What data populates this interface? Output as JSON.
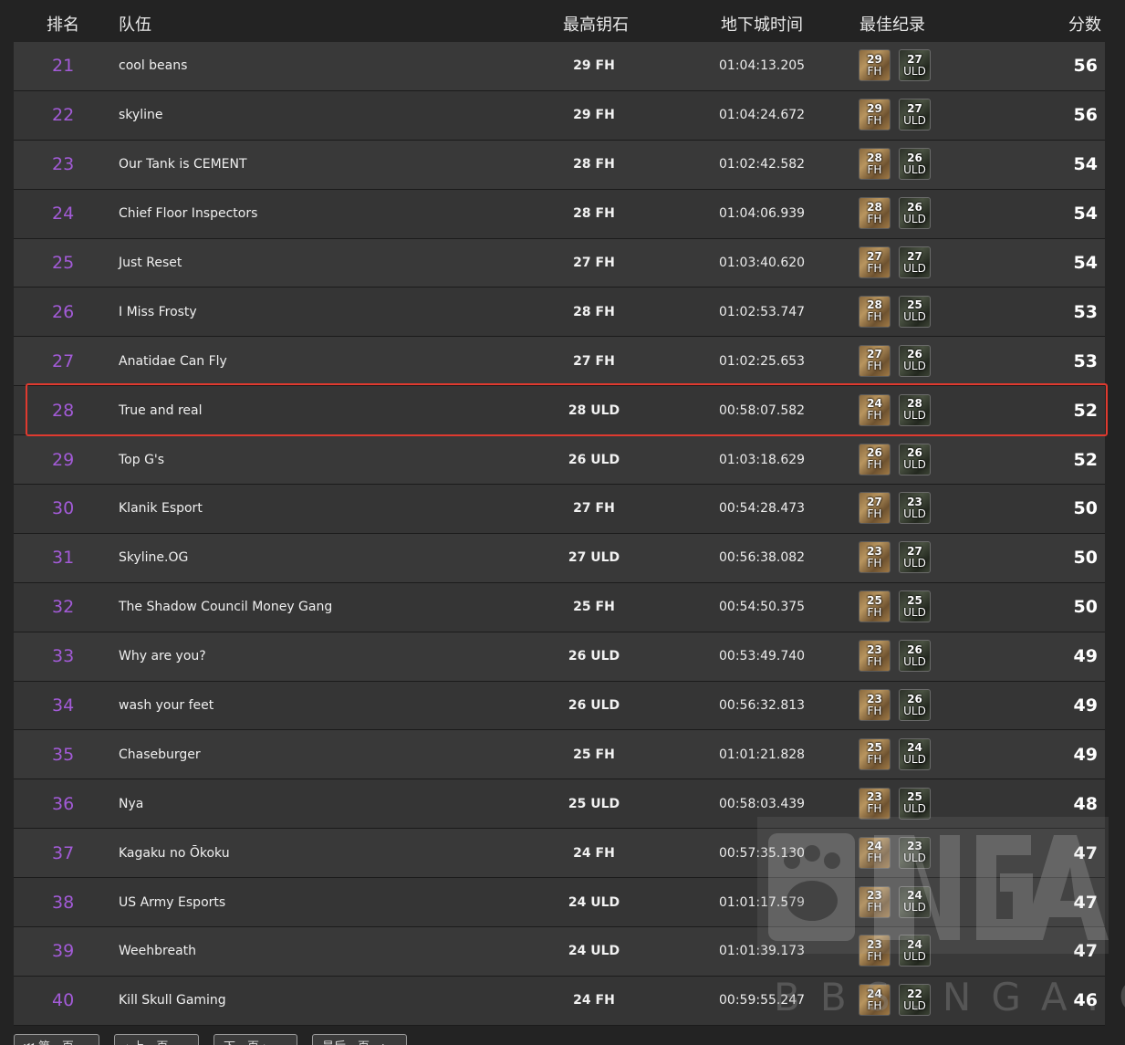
{
  "headers": {
    "rank": "排名",
    "team": "队伍",
    "highest_key": "最高钥石",
    "dungeon_time": "地下城时间",
    "best_record": "最佳纪录",
    "score": "分数"
  },
  "rows": [
    {
      "rank": "21",
      "team": "cool beans",
      "key": "29 FH",
      "time": "01:04:13.205",
      "best": [
        {
          "lvl": "29",
          "dungeon": "FH"
        },
        {
          "lvl": "27",
          "dungeon": "ULD"
        }
      ],
      "score": "56"
    },
    {
      "rank": "22",
      "team": "skyline",
      "key": "29 FH",
      "time": "01:04:24.672",
      "best": [
        {
          "lvl": "29",
          "dungeon": "FH"
        },
        {
          "lvl": "27",
          "dungeon": "ULD"
        }
      ],
      "score": "56"
    },
    {
      "rank": "23",
      "team": "Our Tank is CEMENT",
      "key": "28 FH",
      "time": "01:02:42.582",
      "best": [
        {
          "lvl": "28",
          "dungeon": "FH"
        },
        {
          "lvl": "26",
          "dungeon": "ULD"
        }
      ],
      "score": "54"
    },
    {
      "rank": "24",
      "team": "Chief Floor Inspectors",
      "key": "28 FH",
      "time": "01:04:06.939",
      "best": [
        {
          "lvl": "28",
          "dungeon": "FH"
        },
        {
          "lvl": "26",
          "dungeon": "ULD"
        }
      ],
      "score": "54"
    },
    {
      "rank": "25",
      "team": "Just Reset",
      "key": "27 FH",
      "time": "01:03:40.620",
      "best": [
        {
          "lvl": "27",
          "dungeon": "FH"
        },
        {
          "lvl": "27",
          "dungeon": "ULD"
        }
      ],
      "score": "54"
    },
    {
      "rank": "26",
      "team": "I Miss Frosty",
      "key": "28 FH",
      "time": "01:02:53.747",
      "best": [
        {
          "lvl": "28",
          "dungeon": "FH"
        },
        {
          "lvl": "25",
          "dungeon": "ULD"
        }
      ],
      "score": "53"
    },
    {
      "rank": "27",
      "team": "Anatidae Can Fly",
      "key": "27 FH",
      "time": "01:02:25.653",
      "best": [
        {
          "lvl": "27",
          "dungeon": "FH"
        },
        {
          "lvl": "26",
          "dungeon": "ULD"
        }
      ],
      "score": "53"
    },
    {
      "rank": "28",
      "team": "True and real",
      "key": "28 ULD",
      "time": "00:58:07.582",
      "best": [
        {
          "lvl": "24",
          "dungeon": "FH"
        },
        {
          "lvl": "28",
          "dungeon": "ULD"
        }
      ],
      "score": "52"
    },
    {
      "rank": "29",
      "team": "Top G's",
      "key": "26 ULD",
      "time": "01:03:18.629",
      "best": [
        {
          "lvl": "26",
          "dungeon": "FH"
        },
        {
          "lvl": "26",
          "dungeon": "ULD"
        }
      ],
      "score": "52"
    },
    {
      "rank": "30",
      "team": "Klanik Esport",
      "key": "27 FH",
      "time": "00:54:28.473",
      "best": [
        {
          "lvl": "27",
          "dungeon": "FH"
        },
        {
          "lvl": "23",
          "dungeon": "ULD"
        }
      ],
      "score": "50"
    },
    {
      "rank": "31",
      "team": "Skyline.OG",
      "key": "27 ULD",
      "time": "00:56:38.082",
      "best": [
        {
          "lvl": "23",
          "dungeon": "FH"
        },
        {
          "lvl": "27",
          "dungeon": "ULD"
        }
      ],
      "score": "50"
    },
    {
      "rank": "32",
      "team": "The Shadow Council Money Gang",
      "key": "25 FH",
      "time": "00:54:50.375",
      "best": [
        {
          "lvl": "25",
          "dungeon": "FH"
        },
        {
          "lvl": "25",
          "dungeon": "ULD"
        }
      ],
      "score": "50"
    },
    {
      "rank": "33",
      "team": "Why are you?",
      "key": "26 ULD",
      "time": "00:53:49.740",
      "best": [
        {
          "lvl": "23",
          "dungeon": "FH"
        },
        {
          "lvl": "26",
          "dungeon": "ULD"
        }
      ],
      "score": "49"
    },
    {
      "rank": "34",
      "team": "wash your feet",
      "key": "26 ULD",
      "time": "00:56:32.813",
      "best": [
        {
          "lvl": "23",
          "dungeon": "FH"
        },
        {
          "lvl": "26",
          "dungeon": "ULD"
        }
      ],
      "score": "49"
    },
    {
      "rank": "35",
      "team": "Chaseburger",
      "key": "25 FH",
      "time": "01:01:21.828",
      "best": [
        {
          "lvl": "25",
          "dungeon": "FH"
        },
        {
          "lvl": "24",
          "dungeon": "ULD"
        }
      ],
      "score": "49"
    },
    {
      "rank": "36",
      "team": "Nya",
      "key": "25 ULD",
      "time": "00:58:03.439",
      "best": [
        {
          "lvl": "23",
          "dungeon": "FH"
        },
        {
          "lvl": "25",
          "dungeon": "ULD"
        }
      ],
      "score": "48"
    },
    {
      "rank": "37",
      "team": "Kagaku no Ōkoku",
      "key": "24 FH",
      "time": "00:57:35.130",
      "best": [
        {
          "lvl": "24",
          "dungeon": "FH"
        },
        {
          "lvl": "23",
          "dungeon": "ULD"
        }
      ],
      "score": "47"
    },
    {
      "rank": "38",
      "team": "US Army Esports",
      "key": "24 ULD",
      "time": "01:01:17.579",
      "best": [
        {
          "lvl": "23",
          "dungeon": "FH"
        },
        {
          "lvl": "24",
          "dungeon": "ULD"
        }
      ],
      "score": "47"
    },
    {
      "rank": "39",
      "team": "Weehbreath",
      "key": "24 ULD",
      "time": "01:01:39.173",
      "best": [
        {
          "lvl": "23",
          "dungeon": "FH"
        },
        {
          "lvl": "24",
          "dungeon": "ULD"
        }
      ],
      "score": "47"
    },
    {
      "rank": "40",
      "team": "Kill Skull Gaming",
      "key": "24 FH",
      "time": "00:59:55.247",
      "best": [
        {
          "lvl": "24",
          "dungeon": "FH"
        },
        {
          "lvl": "22",
          "dungeon": "ULD"
        }
      ],
      "score": "46"
    }
  ],
  "highlighted_rank": "28",
  "pager": {
    "first": "⏮ 第一页",
    "prev": "‹ 上一页",
    "next": "下一页 ›",
    "last": "最后一页 ⏭"
  },
  "watermark": {
    "logo": "NGA",
    "text": "BBS.NGA.CN"
  },
  "colors": {
    "rank": "#a35bd8",
    "highlight_border": "#e03a2f",
    "row_bg": "#393939"
  }
}
